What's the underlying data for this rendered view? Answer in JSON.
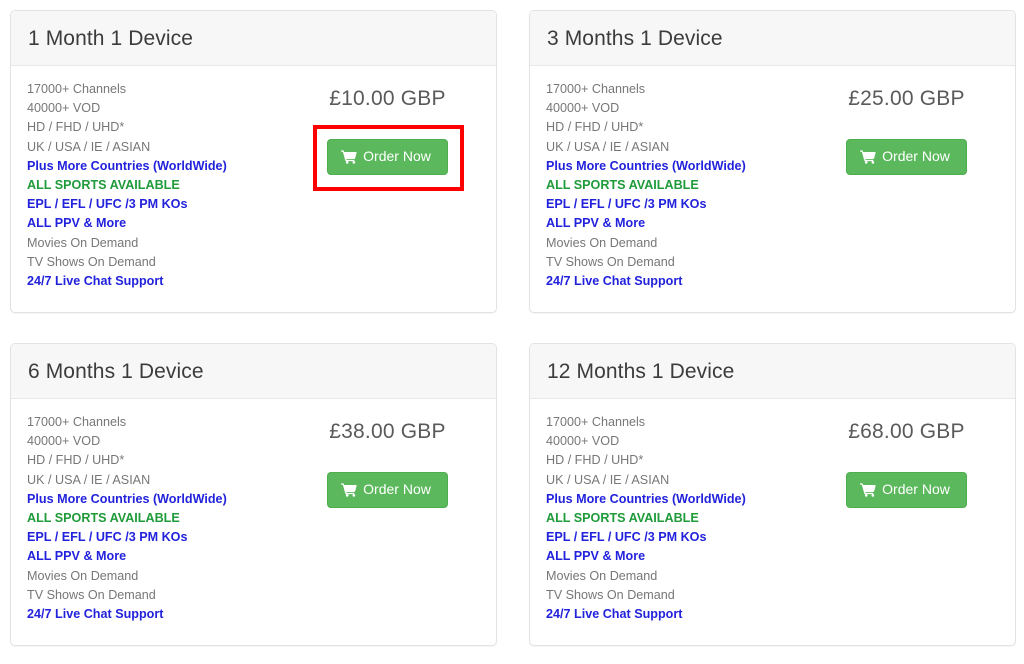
{
  "meta": {
    "accent_green": "#5cb85c",
    "link_blue": "#2222dd",
    "sports_green": "#1f9b3a",
    "text_gray": "#777777",
    "title_gray": "#3c3c3c",
    "highlight_red": "#ff0000",
    "card_header_bg": "#f7f7f7"
  },
  "button": {
    "label": "Order Now",
    "icon": "shopping-cart-icon"
  },
  "features": [
    {
      "text": "17000+ Channels",
      "style": "plain"
    },
    {
      "text": "40000+ VOD",
      "style": "plain"
    },
    {
      "text": "HD / FHD / UHD*",
      "style": "plain"
    },
    {
      "text": "UK / USA / IE / ASIAN",
      "style": "plain"
    },
    {
      "text": "Plus More Countries (WorldWide)",
      "style": "blue"
    },
    {
      "text": "ALL SPORTS AVAILABLE",
      "style": "green"
    },
    {
      "text": "EPL / EFL / UFC /3 PM KOs",
      "style": "blue"
    },
    {
      "text": "ALL PPV & More",
      "style": "blue"
    },
    {
      "text": "Movies On Demand",
      "style": "plain"
    },
    {
      "text": "TV Shows On Demand",
      "style": "plain"
    },
    {
      "text": "24/7 Live Chat Support",
      "style": "blue"
    }
  ],
  "plans": [
    {
      "title": "1 Month 1 Device",
      "price": "£10.00 GBP",
      "highlighted": true
    },
    {
      "title": "3 Months 1 Device",
      "price": "£25.00 GBP",
      "highlighted": false
    },
    {
      "title": "6 Months 1 Device",
      "price": "£38.00 GBP",
      "highlighted": false
    },
    {
      "title": "12 Months 1 Device",
      "price": "£68.00 GBP",
      "highlighted": false
    }
  ]
}
